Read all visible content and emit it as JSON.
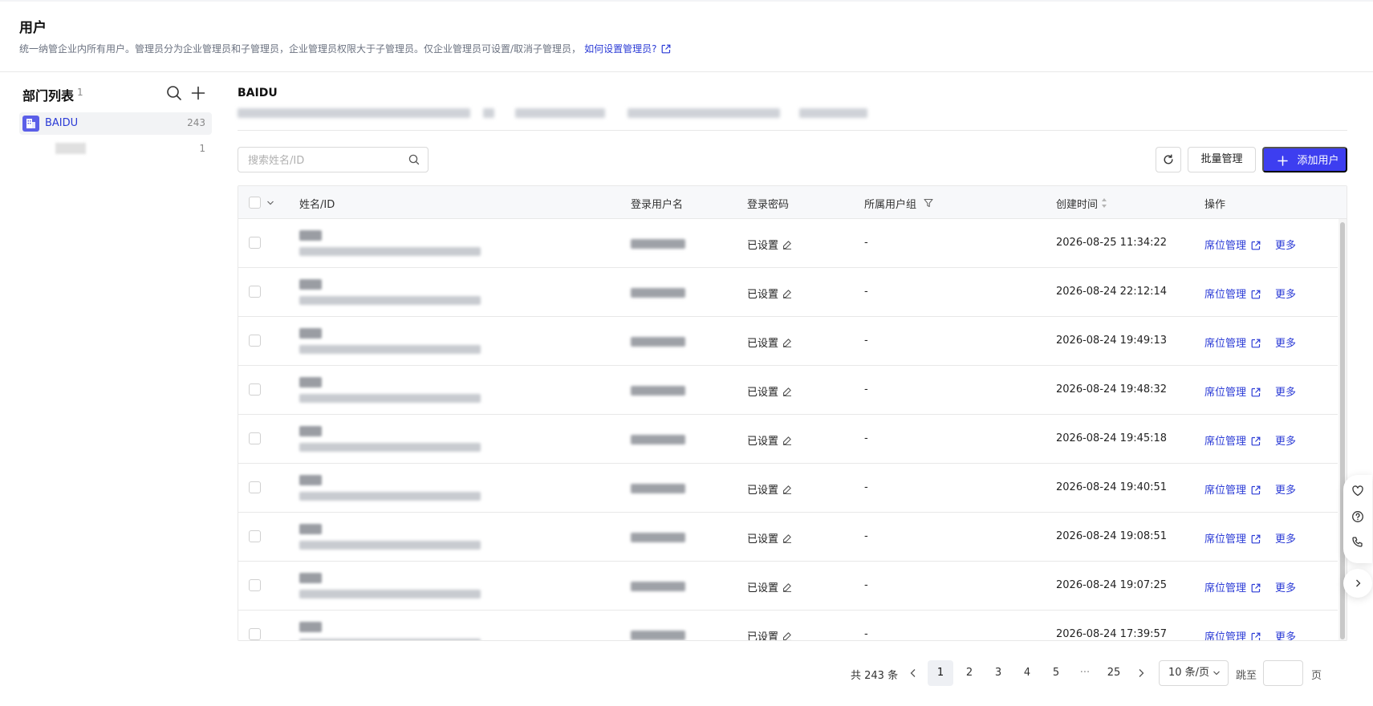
{
  "page": {
    "title": "用户",
    "description": "统一纳管企业内所有用户。管理员分为企业管理员和子管理员，企业管理员权限大于子管理员。仅企业管理员可设置/取消子管理员，",
    "help_link": "如何设置管理员?"
  },
  "departments": {
    "title": "部门列表",
    "count": "1",
    "items": [
      {
        "name": "BAIDU",
        "count": "243"
      }
    ],
    "sub_items": [
      {
        "count": "1"
      }
    ]
  },
  "org": {
    "name": "BAIDU"
  },
  "toolbar": {
    "search_placeholder": "搜索姓名/ID",
    "batch_label": "批量管理",
    "add_label": "添加用户"
  },
  "table": {
    "columns": {
      "name": "姓名/ID",
      "username": "登录用户名",
      "password": "登录密码",
      "group": "所属用户组",
      "created": "创建时间",
      "actions": "操作"
    },
    "rows": [
      {
        "password": "已设置",
        "group": "-",
        "created": "2026-08-25 11:34:22",
        "seat": "席位管理",
        "more": "更多"
      },
      {
        "password": "已设置",
        "group": "-",
        "created": "2026-08-24 22:12:14",
        "seat": "席位管理",
        "more": "更多"
      },
      {
        "password": "已设置",
        "group": "-",
        "created": "2026-08-24 19:49:13",
        "seat": "席位管理",
        "more": "更多"
      },
      {
        "password": "已设置",
        "group": "-",
        "created": "2026-08-24 19:48:32",
        "seat": "席位管理",
        "more": "更多"
      },
      {
        "password": "已设置",
        "group": "-",
        "created": "2026-08-24 19:45:18",
        "seat": "席位管理",
        "more": "更多"
      },
      {
        "password": "已设置",
        "group": "-",
        "created": "2026-08-24 19:40:51",
        "seat": "席位管理",
        "more": "更多"
      },
      {
        "password": "已设置",
        "group": "-",
        "created": "2026-08-24 19:08:51",
        "seat": "席位管理",
        "more": "更多"
      },
      {
        "password": "已设置",
        "group": "-",
        "created": "2026-08-24 19:07:25",
        "seat": "席位管理",
        "more": "更多"
      },
      {
        "password": "已设置",
        "group": "-",
        "created": "2026-08-24 17:39:57",
        "seat": "席位管理",
        "more": "更多"
      }
    ]
  },
  "pagination": {
    "total": "共 243 条",
    "pages": [
      "1",
      "2",
      "3",
      "4",
      "5",
      "···",
      "25"
    ],
    "current": "1",
    "page_size": "10 条/页",
    "jump_label": "跳至",
    "page_label": "页"
  },
  "colors": {
    "primary": "#3d3ef0",
    "link": "#2b3bd6",
    "dept_badge": "#5b5fe8"
  }
}
